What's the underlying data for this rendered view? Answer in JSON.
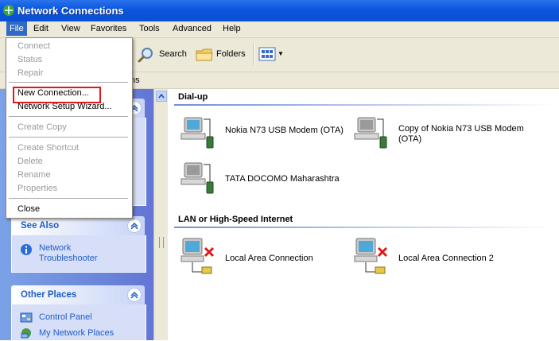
{
  "window": {
    "title": "Network Connections"
  },
  "menubar": {
    "items": [
      "File",
      "Edit",
      "View",
      "Favorites",
      "Tools",
      "Advanced",
      "Help"
    ]
  },
  "toolbar": {
    "search_label": "Search",
    "folders_label": "Folders"
  },
  "address": {
    "visible_text": "ns"
  },
  "file_menu": {
    "items": [
      {
        "label": "Connect",
        "enabled": false
      },
      {
        "label": "Status",
        "enabled": false
      },
      {
        "label": "Repair",
        "enabled": false
      },
      {
        "label": "New Connection...",
        "enabled": true
      },
      {
        "label": "Network Setup Wizard...",
        "enabled": true
      },
      {
        "label": "Create Copy",
        "enabled": false
      },
      {
        "label": "Create Shortcut",
        "enabled": false
      },
      {
        "label": "Delete",
        "enabled": false
      },
      {
        "label": "Rename",
        "enabled": false
      },
      {
        "label": "Properties",
        "enabled": false
      },
      {
        "label": "Close",
        "enabled": true
      }
    ]
  },
  "left_pane": {
    "see_also": {
      "title": "See Also",
      "links": [
        "Network Troubleshooter"
      ]
    },
    "other_places": {
      "title": "Other Places",
      "links": [
        "Control Panel",
        "My Network Places"
      ]
    }
  },
  "content": {
    "groups": [
      {
        "title": "Dial-up",
        "items": [
          "Nokia N73 USB Modem (OTA)",
          "Copy of Nokia N73 USB Modem (OTA)",
          "TATA DOCOMO Maharashtra"
        ]
      },
      {
        "title": "LAN or High-Speed Internet",
        "items": [
          "Local Area Connection",
          "Local Area Connection 2"
        ]
      }
    ]
  },
  "colors": {
    "titlebar": "#0a56dd",
    "highlight_box": "#e4161b",
    "menu_active": "#316ac5",
    "link": "#215dc6"
  }
}
